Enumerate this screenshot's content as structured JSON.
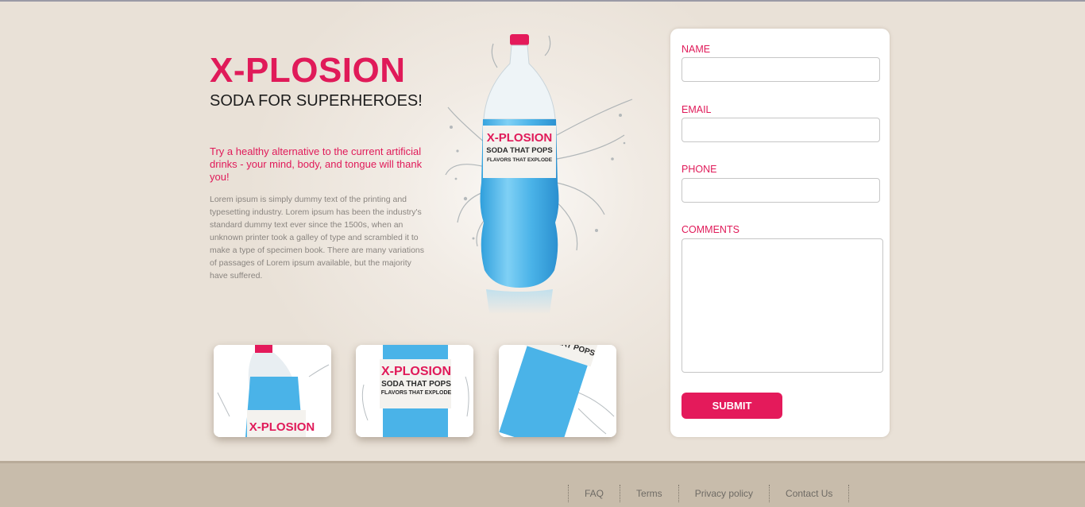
{
  "hero": {
    "title": "X-PLOSION",
    "subtitle": "SODA FOR SUPERHEROES!",
    "tagline": "Try a healthy alternative to the current artificial drinks - your mind, body, and tongue will thank you!",
    "description": "Lorem ipsum is simply dummy text of the printing and typesetting industry. Lorem ipsum has been the industry's standard dummy text ever since the 1500s, when an unknown printer took a galley of type and scrambled it to make a type of specimen book. There are many variations of passages of Lorem ipsum available, but the majority have suffered."
  },
  "product_label": {
    "brand": "X-PLOSION",
    "line1": "SODA THAT POPS",
    "line2": "FLAVORS THAT EXPLODE"
  },
  "gallery": {
    "thumbnails": [
      "bottle-top-view",
      "bottle-label-view",
      "bottle-tilted-view"
    ]
  },
  "form": {
    "name_label": "NAME",
    "name_value": "",
    "email_label": "EMAIL",
    "email_value": "",
    "phone_label": "PHONE",
    "phone_value": "",
    "comments_label": "COMMENTS",
    "comments_value": "",
    "submit_label": "SUBMIT"
  },
  "footer": {
    "links": [
      "FAQ",
      "Terms",
      "Privacy policy",
      "Contact Us"
    ]
  },
  "colors": {
    "accent": "#e01a59",
    "background": "#eae2d8",
    "footer": "#c8bcab",
    "bottle_liquid": "#4ab3e8"
  }
}
